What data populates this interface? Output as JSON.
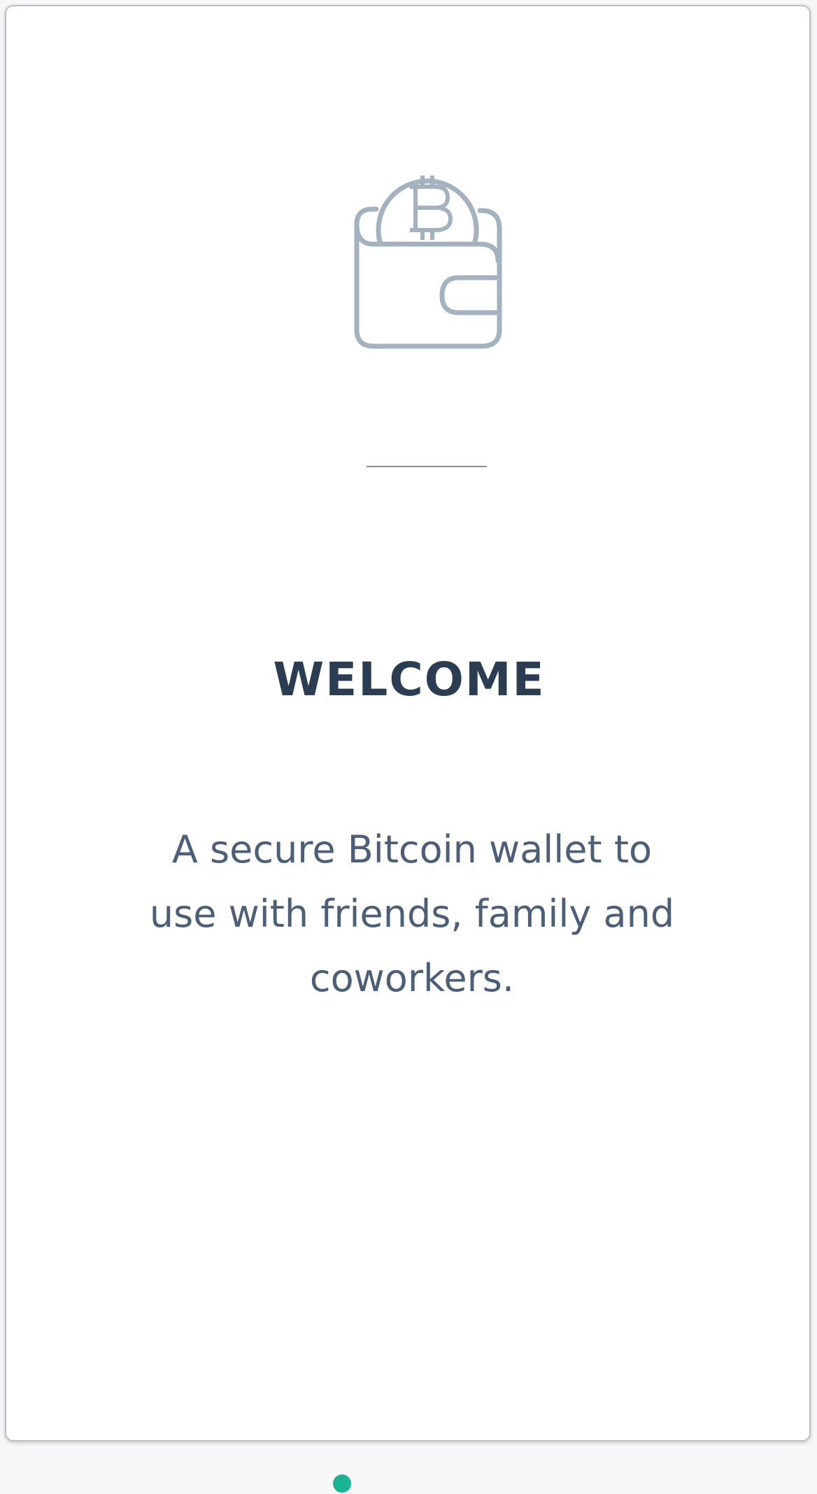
{
  "onboarding": {
    "icon": "bitcoin-wallet-icon",
    "title": "WELCOME",
    "description": "A secure Bitcoin wallet to use with friends, family and coworkers."
  },
  "pager": {
    "active_index": 0,
    "active_color": "#1ab394"
  },
  "colors": {
    "title": "#2b3d52",
    "text": "#4d5f78",
    "icon": "#a4b1bf",
    "accent": "#1ab394"
  }
}
